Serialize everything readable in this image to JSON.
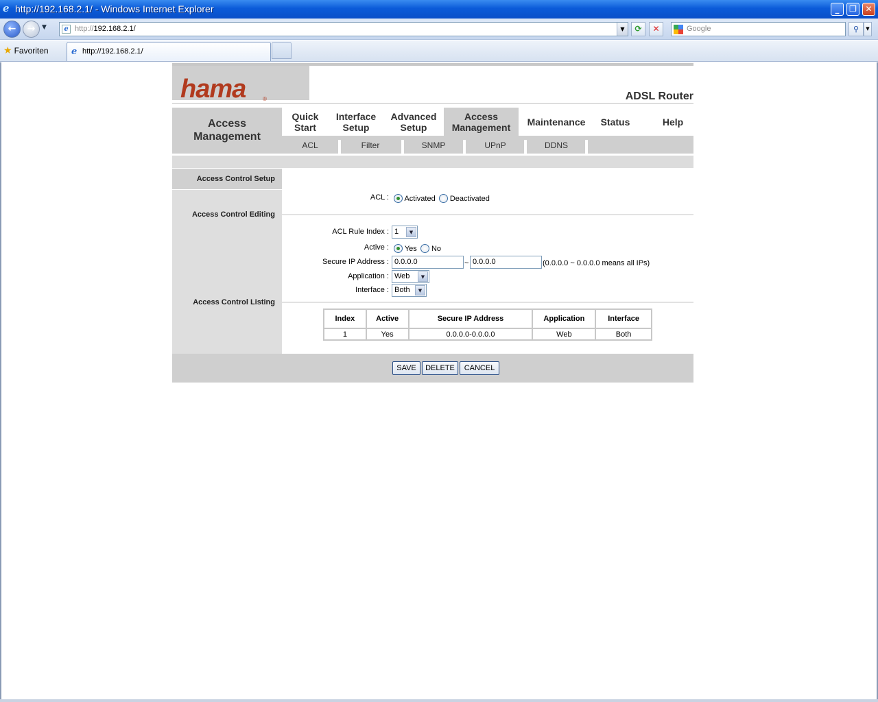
{
  "browser": {
    "window_title": "http://192.168.2.1/ - Windows Internet Explorer",
    "address_scheme": "http://",
    "address_host": "192.168.2.1/",
    "search_placeholder": "Google",
    "favorites_label": "Favoriten",
    "tab_title": "http://192.168.2.1/"
  },
  "router": {
    "brand": "hama",
    "product": "ADSL Router",
    "section_title_line1": "Access",
    "section_title_line2": "Management",
    "nav": [
      {
        "line1": "Quick",
        "line2": "Start"
      },
      {
        "line1": "Interface",
        "line2": "Setup"
      },
      {
        "line1": "Advanced",
        "line2": "Setup"
      },
      {
        "line1": "Access",
        "line2": "Management"
      },
      {
        "line1": "Maintenance",
        "line2": ""
      },
      {
        "line1": "Status",
        "line2": ""
      },
      {
        "line1": "Help",
        "line2": ""
      }
    ],
    "subnav": [
      "ACL",
      "Filter",
      "SNMP",
      "UPnP",
      "DDNS"
    ],
    "left_labels": {
      "setup": "Access Control Setup",
      "editing": "Access Control Editing",
      "listing": "Access Control Listing"
    },
    "acl": {
      "label": "ACL :",
      "option_activated": "Activated",
      "option_deactivated": "Deactivated",
      "selected": "Activated"
    },
    "editing": {
      "rule_index_label": "ACL Rule Index :",
      "rule_index_value": "1",
      "active_label": "Active :",
      "active_yes": "Yes",
      "active_no": "No",
      "secure_ip_label": "Secure IP Address :",
      "ip_start": "0.0.0.0",
      "ip_separator": "~",
      "ip_end": "0.0.0.0",
      "ip_hint": "(0.0.0.0 ~ 0.0.0.0 means all IPs)",
      "application_label": "Application :",
      "application_value": "Web",
      "interface_label": "Interface :",
      "interface_value": "Both"
    },
    "listing": {
      "headers": [
        "Index",
        "Active",
        "Secure IP Address",
        "Application",
        "Interface"
      ],
      "rows": [
        [
          "1",
          "Yes",
          "0.0.0.0-0.0.0.0",
          "Web",
          "Both"
        ]
      ]
    },
    "buttons": {
      "save": "SAVE",
      "delete": "DELETE",
      "cancel": "CANCEL"
    }
  }
}
